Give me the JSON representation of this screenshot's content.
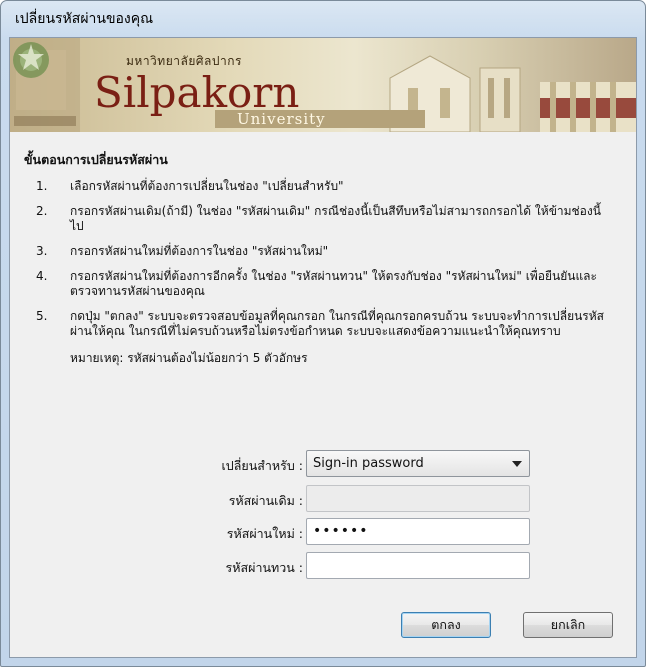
{
  "window": {
    "title": "เปลี่ยนรหัสผ่านของคุณ"
  },
  "banner": {
    "thai_name": "มหาวิทยาลัยศิลปากร",
    "name": "Silpakorn",
    "sub": "University"
  },
  "instructions": {
    "heading": "ขั้นตอนการเปลี่ยนรหัสผ่าน",
    "steps": [
      {
        "num": "1.",
        "text": "เลือกรหัสผ่านที่ต้องการเปลี่ยนในช่อง \"เปลี่ยนสำหรับ\""
      },
      {
        "num": "2.",
        "text": "กรอกรหัสผ่านเดิม(ถ้ามี) ในช่อง \"รหัสผ่านเดิม\" กรณีช่องนี้เป็นสีทึบหรือไม่สามารถกรอกได้ ให้ข้ามช่องนี้ไป"
      },
      {
        "num": "3.",
        "text": "กรอกรหัสผ่านใหม่ที่ต้องการในช่อง \"รหัสผ่านใหม่\""
      },
      {
        "num": "4.",
        "text": "กรอกรหัสผ่านใหม่ที่ต้องการอีกครั้ง ในช่อง \"รหัสผ่านทวน\" ให้ตรงกับช่อง \"รหัสผ่านใหม่\" เพื่อยืนยันและตรวจทานรหัสผ่านของคุณ"
      },
      {
        "num": "5.",
        "text": "กดปุ่ม \"ตกลง\" ระบบจะตรวจสอบข้อมูลที่คุณกรอก ในกรณีที่คุณกรอกครบถ้วน ระบบจะทำการเปลี่ยนรหัสผ่านให้คุณ ในกรณีที่ไม่ครบถ้วนหรือไม่ตรงข้อกำหนด ระบบจะแสดงข้อความแนะนำให้คุณทราบ"
      }
    ],
    "note": "หมายเหตุ: รหัสผ่านต้องไม่น้อยกว่า 5 ตัวอักษร"
  },
  "form": {
    "change_for_label": "เปลี่ยนสำหรับ :",
    "change_for_value": "Sign-in password",
    "old_password_label": "รหัสผ่านเดิม :",
    "old_password_value": "",
    "new_password_label": "รหัสผ่านใหม่ :",
    "new_password_value": "••••••",
    "confirm_password_label": "รหัสผ่านทวน :",
    "confirm_password_value": ""
  },
  "buttons": {
    "ok": "ตกลง",
    "cancel": "ยกเลิก"
  }
}
